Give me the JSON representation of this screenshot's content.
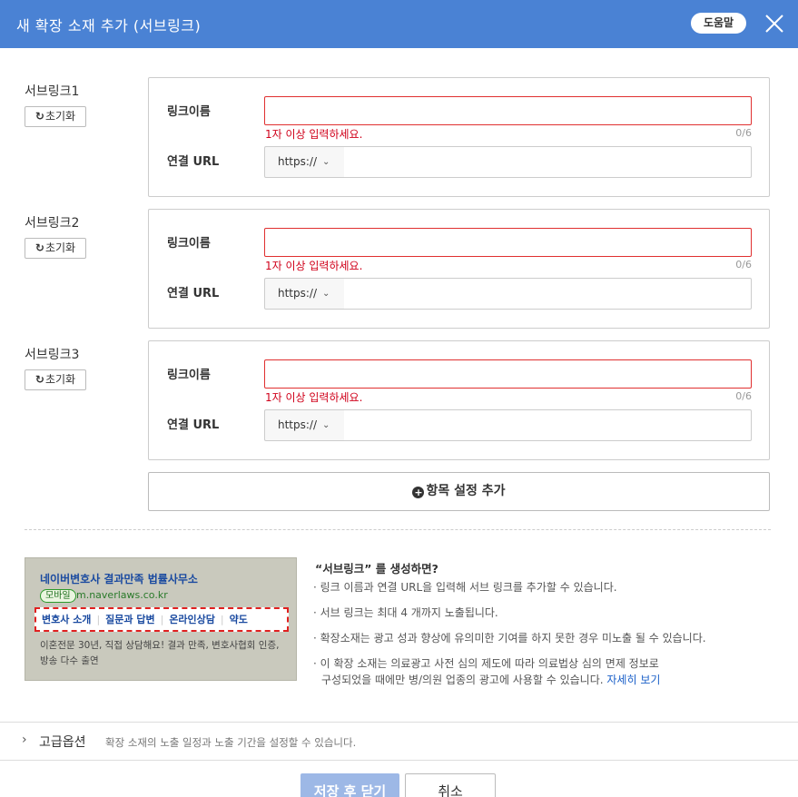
{
  "header": {
    "title": "새 확장 소재 추가 (서브링크)",
    "help_label": "도움말",
    "bg_color": "#4a82d4"
  },
  "sublinks": [
    {
      "label": "서브링크1",
      "reset_label": "초기화",
      "name_label": "링크이름",
      "name_value": "",
      "error": "1자 이상 입력하세요.",
      "count": "0/6",
      "url_label": "연결 URL",
      "protocol": "https://",
      "url_value": ""
    },
    {
      "label": "서브링크2",
      "reset_label": "초기화",
      "name_label": "링크이름",
      "name_value": "",
      "error": "1자 이상 입력하세요.",
      "count": "0/6",
      "url_label": "연결 URL",
      "protocol": "https://",
      "url_value": ""
    },
    {
      "label": "서브링크3",
      "reset_label": "초기화",
      "name_label": "링크이름",
      "name_value": "",
      "error": "1자 이상 입력하세요.",
      "count": "0/6",
      "url_label": "연결 URL",
      "protocol": "https://",
      "url_value": ""
    }
  ],
  "add_item_label": "항목 설정 추가",
  "preview": {
    "title": "네이버변호사 결과만족 법률사무소",
    "badge": "모바일",
    "url": "m.naverlaws.co.kr",
    "links": [
      "변호사 소개",
      "질문과 답변",
      "온라인상담",
      "약도"
    ],
    "desc_line1": "이혼전문 30년, 직접 상담해요! 결과 만족, 변호사협회 인증,",
    "desc_line2": "방송 다수 출연"
  },
  "info": {
    "title": "“서브링크” 를 생성하면?",
    "items": [
      "· 링크 이름과 연결 URL을 입력해 서브 링크를 추가할 수 있습니다.",
      "· 서브 링크는 최대 4 개까지 노출됩니다.",
      "· 확장소재는 광고 성과 향상에 유의미한 기여를 하지 못한 경우 미노출 될 수 있습니다.",
      "· 이 확장 소재는 의료광고 사전 심의 제도에 따라 의료법상 심의 면제 정보로"
    ],
    "item4_line2": "구성되었을 때에만 병/의원 업종의 광고에 사용할 수 있습니다.",
    "more_label": "자세히 보기"
  },
  "advanced": {
    "label": "고급옵션",
    "desc": "확장 소재의 노출 일정과 노출 기간을 설정할 수 있습니다."
  },
  "footer": {
    "save_label": "저장 후 닫기",
    "cancel_label": "취소"
  }
}
